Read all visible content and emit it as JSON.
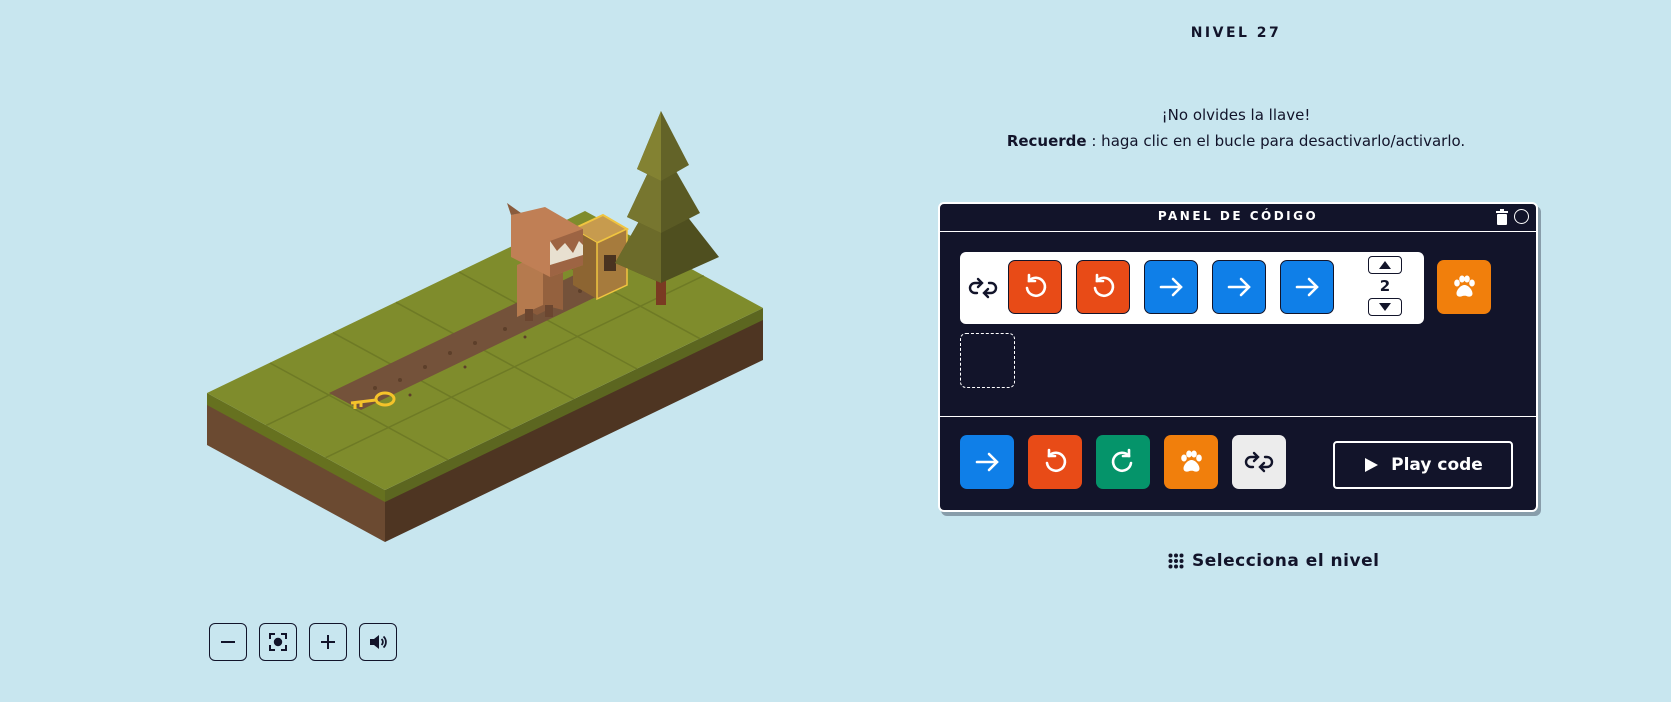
{
  "level": {
    "title": "NIVEL 27"
  },
  "hint": {
    "line1": "¡No olvides la llave!",
    "remember_label": "Recuerde",
    "remember_text": " : haga clic en el bucle para desactivarlo/activarlo."
  },
  "panel": {
    "title": "PANEL DE CÓDIGO",
    "loop": {
      "blocks": [
        "turn-left",
        "turn-left",
        "forward",
        "forward",
        "forward"
      ],
      "repeat_count": "2"
    },
    "palette": [
      "forward",
      "turn-left",
      "turn-right",
      "paw",
      "loop"
    ],
    "play_label": "Play code"
  },
  "select_level": {
    "label": "Selecciona el nivel"
  },
  "scene_controls": [
    "zoom-out",
    "recenter",
    "zoom-in",
    "sound"
  ],
  "colors": {
    "background": "#c8e6ef",
    "panel": "#12142a",
    "forward": "#0f7fe8",
    "turn_left": "#e84b17",
    "turn_right": "#05946a",
    "paw": "#f17f0c",
    "loop": "#ececec",
    "grass": "#7f8c2c",
    "soil": "#6b4a31"
  }
}
